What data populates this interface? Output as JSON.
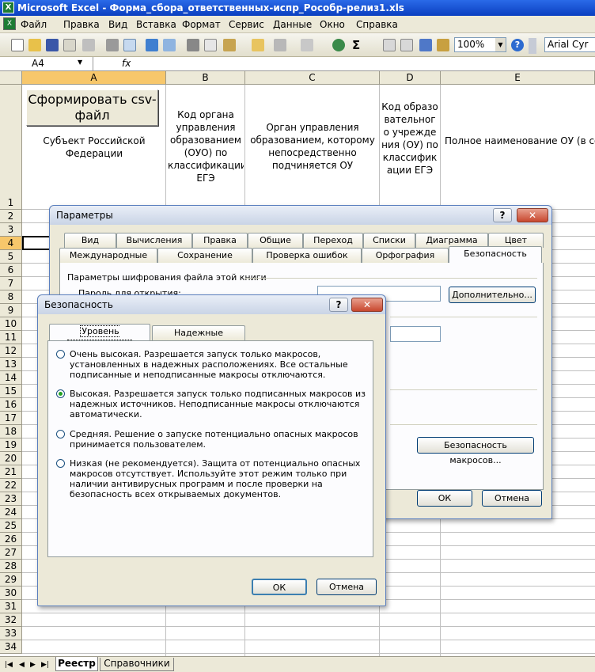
{
  "window": {
    "title": "Microsoft Excel - Форма_сбора_ответственных-испр_Рособр-релиз1.xls"
  },
  "menu": [
    "Файл",
    "Правка",
    "Вид",
    "Вставка",
    "Формат",
    "Сервис",
    "Данные",
    "Окно",
    "Справка"
  ],
  "toolbar": {
    "zoom": "100%",
    "font": "Arial Cyr"
  },
  "formula_bar": {
    "cell_ref": "A4",
    "fx": "fx"
  },
  "columns": [
    "A",
    "B",
    "C",
    "D",
    "E"
  ],
  "rows": [
    "1",
    "2",
    "3",
    "4",
    "5",
    "6",
    "7",
    "8",
    "9",
    "10",
    "11",
    "12",
    "13",
    "14",
    "15",
    "16",
    "17",
    "18",
    "19",
    "20",
    "21",
    "22",
    "23",
    "24",
    "25",
    "26",
    "27",
    "28",
    "29",
    "30",
    "31",
    "32",
    "33",
    "34"
  ],
  "sheet": {
    "csv_button": "Сформировать csv-файл",
    "a1": "Субъект Российской Федерации",
    "b1": "Код органа управления образованием (ОУО) по классификации ЕГЭ",
    "c1": "Орган управления образованием, которому непосредственно подчиняется ОУ",
    "d1": "Код образовательного учреждения (ОУ) по классификации ЕГЭ",
    "e1": "Полное наименование ОУ (в со документами), наименовани"
  },
  "sheet_tabs": [
    "Реестр",
    "Справочники"
  ],
  "params_dialog": {
    "title": "Параметры",
    "tabs_row1": [
      "Вид",
      "Вычисления",
      "Правка",
      "Общие",
      "Переход",
      "Списки",
      "Диаграмма",
      "Цвет"
    ],
    "tabs_row2": [
      "Международные",
      "Сохранение",
      "Проверка ошибок",
      "Орфография",
      "Безопасность"
    ],
    "group_label": "Параметры шифрования файла этой книги",
    "open_password_label": "Пароль для открытия:",
    "advanced_button": "Дополнительно...",
    "macro_security_button": "Безопасность макросов...",
    "ok": "ОК",
    "cancel": "Отмена"
  },
  "security_dialog": {
    "title": "Безопасность",
    "tabs": [
      "Уровень безопасности",
      "Надежные издатели"
    ],
    "options": [
      {
        "label": "Очень высокая. Разрешается запуск только макросов, установленных в надежных расположениях. Все остальные подписанные и неподписанные макросы отключаются.",
        "selected": false
      },
      {
        "label": "Высокая. Разрешается запуск только подписанных макросов из надежных источников. Неподписанные макросы отключаются автоматически.",
        "selected": true
      },
      {
        "label": "Средняя. Решение о запуске потенциально опасных макросов принимается пользователем.",
        "selected": false
      },
      {
        "label": "Низкая (не рекомендуется). Защита от потенциально опасных макросов отсутствует. Используйте этот режим только при наличии антивирусных программ и после проверки на безопасность всех открываемых документов.",
        "selected": false
      }
    ],
    "ok": "ОК",
    "cancel": "Отмена"
  }
}
